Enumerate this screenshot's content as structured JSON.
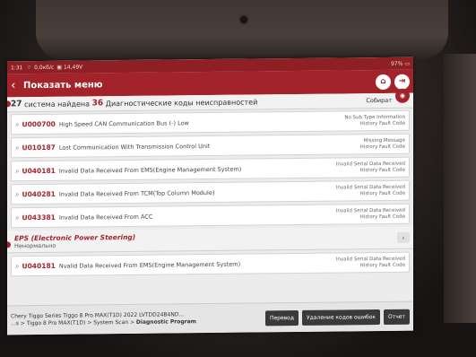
{
  "status_bar": {
    "time": "1:31",
    "network": "0,0кб/с",
    "voltage": "14,49V",
    "battery": "97%"
  },
  "app_bar": {
    "title": "Показать меню",
    "home_icon": "home-icon",
    "exit_icon": "exit-icon"
  },
  "summary": {
    "systems_count": "27",
    "systems_text": "система найдена",
    "codes_count": "36",
    "codes_text": "Диагностические коды неисправностей",
    "collect_label": "Собират"
  },
  "faults": [
    {
      "code": "U000700",
      "description": "High Speed CAN Communication Bus (-) Low",
      "status1": "No Sub Type Information",
      "status2": "History Fault Code"
    },
    {
      "code": "U010187",
      "description": "Lost Communication With Transmission Control Unit",
      "status1": "Missing Message",
      "status2": "History Fault Code"
    },
    {
      "code": "U040181",
      "description": "Invalid Data Received From EMS(Engine Management System)",
      "status1": "Invalid Serial Data Received",
      "status2": "History Fault Code"
    },
    {
      "code": "U040281",
      "description": "Invalid Data Received From TCM(Top Column Module)",
      "status1": "Invalid Serial Data Received",
      "status2": "History Fault Code"
    },
    {
      "code": "U043381",
      "description": "Invalid Data Received From ACC",
      "status1": "Invalid Serial Data Received",
      "status2": "History Fault Code"
    }
  ],
  "eps_system": {
    "name": "EPS (Electronic Power Steering)",
    "state": "Ненормально",
    "faults": [
      {
        "code": "U040181",
        "description": "Nvalid Data Received From EMS(Engine Management System)",
        "status1": "Invalid Serial Data Received",
        "status2": "History Fault Code"
      }
    ]
  },
  "footer": {
    "vehicle_line": "Chery  Tiggo Series Tiggo 8 Pro MAX(T1D) 2022  LVTDD24B4ND...",
    "path_prefix": "...s > Tiggo 8 Pro MAX(T1D) > System Scan > ",
    "path_current": "Diagnostic Program",
    "buttons": {
      "translate": "Перевод",
      "clear_codes": "Удаление кодов ошибок",
      "report": "Отчет"
    }
  },
  "colors": {
    "accent": "#a3232a",
    "status_bar": "#8e1f24"
  }
}
